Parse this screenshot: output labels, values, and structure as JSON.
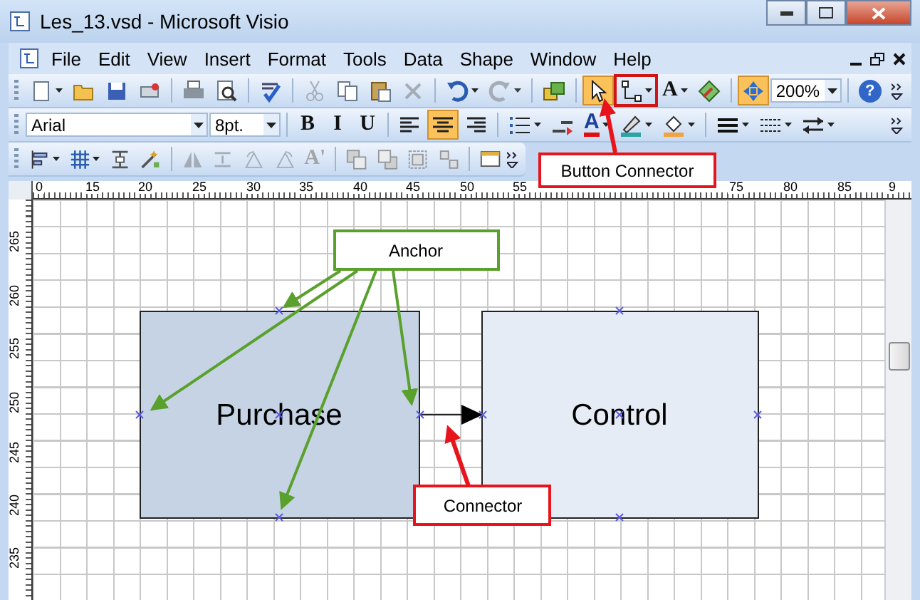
{
  "window": {
    "title": "Les_13.vsd - Microsoft Visio"
  },
  "menu_bar": {
    "items": [
      {
        "label": "File"
      },
      {
        "label": "Edit"
      },
      {
        "label": "View"
      },
      {
        "label": "Insert"
      },
      {
        "label": "Format"
      },
      {
        "label": "Tools"
      },
      {
        "label": "Data"
      },
      {
        "label": "Shape"
      },
      {
        "label": "Window"
      },
      {
        "label": "Help"
      }
    ]
  },
  "toolbars": [
    {
      "items": [
        {
          "kind": "new",
          "dropdown": true,
          "selected": false,
          "disabled": false
        },
        {
          "kind": "open",
          "dropdown": false,
          "selected": false,
          "disabled": false
        },
        {
          "kind": "save",
          "dropdown": false,
          "selected": false,
          "disabled": false
        },
        {
          "kind": "permission",
          "dropdown": false,
          "selected": false,
          "disabled": false
        },
        {
          "kind": "separator"
        },
        {
          "kind": "print",
          "dropdown": false,
          "selected": false,
          "disabled": false
        },
        {
          "kind": "preview",
          "dropdown": false,
          "selected": false,
          "disabled": false
        },
        {
          "kind": "separator"
        },
        {
          "kind": "spell",
          "dropdown": false,
          "selected": false,
          "disabled": false
        },
        {
          "kind": "separator"
        },
        {
          "kind": "cut",
          "dropdown": false,
          "selected": false,
          "disabled": true
        },
        {
          "kind": "copy",
          "dropdown": false,
          "selected": false,
          "disabled": false
        },
        {
          "kind": "paste",
          "dropdown": false,
          "selected": false,
          "disabled": false
        },
        {
          "kind": "delete",
          "dropdown": false,
          "selected": false,
          "disabled": true
        },
        {
          "kind": "separator"
        },
        {
          "kind": "undo",
          "dropdown": true,
          "selected": false,
          "disabled": false
        },
        {
          "kind": "redo",
          "dropdown": true,
          "selected": false,
          "disabled": true
        },
        {
          "kind": "separator"
        },
        {
          "kind": "shapes",
          "dropdown": false,
          "selected": false,
          "disabled": false
        },
        {
          "kind": "separator"
        },
        {
          "kind": "pointer",
          "dropdown": false,
          "selected": true,
          "disabled": false
        },
        {
          "kind": "connector",
          "dropdown": true,
          "selected": false,
          "disabled": false,
          "annotated": true
        },
        {
          "kind": "text",
          "label": "A",
          "dropdown": true,
          "selected": false,
          "disabled": false
        },
        {
          "kind": "connection-point",
          "dropdown": false,
          "selected": false,
          "disabled": false
        },
        {
          "kind": "separator"
        },
        {
          "kind": "pan",
          "dropdown": false,
          "selected": true,
          "disabled": false
        },
        {
          "kind": "field",
          "value": "200%"
        },
        {
          "kind": "separator"
        },
        {
          "kind": "help",
          "label": "?",
          "dropdown": false,
          "selected": false,
          "disabled": false
        }
      ]
    },
    {
      "items": [
        {
          "kind": "field",
          "value": "Arial"
        },
        {
          "kind": "field",
          "value": "8pt."
        },
        {
          "kind": "separator"
        },
        {
          "kind": "text",
          "label": "B",
          "dropdown": false,
          "selected": false,
          "disabled": false
        },
        {
          "kind": "text",
          "label": "I",
          "dropdown": false,
          "selected": false,
          "disabled": false
        },
        {
          "kind": "text",
          "label": "U",
          "dropdown": false,
          "selected": false,
          "disabled": false
        },
        {
          "kind": "separator"
        },
        {
          "kind": "align-left",
          "dropdown": false,
          "selected": false,
          "disabled": false
        },
        {
          "kind": "align-center",
          "dropdown": false,
          "selected": true,
          "disabled": false
        },
        {
          "kind": "align-right",
          "dropdown": false,
          "selected": false,
          "disabled": false
        },
        {
          "kind": "separator"
        },
        {
          "kind": "bullets",
          "dropdown": true,
          "selected": false,
          "disabled": false
        },
        {
          "kind": "indent",
          "dropdown": false,
          "selected": false,
          "disabled": false
        },
        {
          "kind": "font-color",
          "label": "A",
          "dropdown": true,
          "selected": false,
          "disabled": false
        },
        {
          "kind": "line-color",
          "dropdown": true,
          "selected": false,
          "disabled": false
        },
        {
          "kind": "fill-color",
          "dropdown": true,
          "selected": false,
          "disabled": false
        },
        {
          "kind": "separator"
        },
        {
          "kind": "line-weight",
          "dropdown": true,
          "selected": false,
          "disabled": false
        },
        {
          "kind": "line-pattern",
          "dropdown": true,
          "selected": false,
          "disabled": false
        },
        {
          "kind": "line-ends",
          "dropdown": true,
          "selected": false,
          "disabled": false
        }
      ]
    },
    {
      "items": [
        {
          "kind": "align-shapes",
          "dropdown": true,
          "selected": false,
          "disabled": false
        },
        {
          "kind": "snap",
          "dropdown": true,
          "selected": false,
          "disabled": false
        },
        {
          "kind": "distribute",
          "dropdown": false,
          "selected": false,
          "disabled": false
        },
        {
          "kind": "connect-shapes",
          "dropdown": false,
          "selected": false,
          "disabled": false
        },
        {
          "kind": "separator"
        },
        {
          "kind": "flip-horizontal",
          "dropdown": false,
          "selected": false,
          "disabled": true
        },
        {
          "kind": "flip-vertical",
          "dropdown": false,
          "selected": false,
          "disabled": true
        },
        {
          "kind": "rotate-left",
          "dropdown": false,
          "selected": false,
          "disabled": true
        },
        {
          "kind": "rotate-right",
          "dropdown": false,
          "selected": false,
          "disabled": true
        },
        {
          "kind": "text",
          "label": "A'",
          "dropdown": false,
          "selected": false,
          "disabled": true
        },
        {
          "kind": "separator"
        },
        {
          "kind": "bring-front",
          "dropdown": false,
          "selected": false,
          "disabled": true
        },
        {
          "kind": "send-back",
          "dropdown": false,
          "selected": false,
          "disabled": true
        },
        {
          "kind": "group",
          "dropdown": false,
          "selected": false,
          "disabled": true
        },
        {
          "kind": "ungroup",
          "dropdown": false,
          "selected": false,
          "disabled": true
        },
        {
          "kind": "separator"
        },
        {
          "kind": "layer",
          "dropdown": false,
          "selected": false,
          "disabled": false
        }
      ]
    }
  ],
  "rulers": {
    "horizontal": [
      "0",
      "15",
      "20",
      "25",
      "30",
      "35",
      "40",
      "45",
      "50",
      "55",
      "75",
      "80",
      "85",
      "9"
    ],
    "vertical": [
      "265",
      "260",
      "255",
      "250",
      "245",
      "240",
      "235"
    ]
  },
  "diagram": {
    "shapes": [
      {
        "label": "Purchase",
        "color": "#c5d3e4"
      },
      {
        "label": "Control",
        "color": "#e6ecf6"
      }
    ],
    "callouts": [
      {
        "kind": "anchor",
        "label": "Anchor",
        "color": "#5aa02c"
      },
      {
        "kind": "connector",
        "label": "Connector",
        "color": "#e8141b"
      }
    ]
  },
  "button_callout": {
    "label": "Button Connector",
    "color": "#e8141b"
  }
}
